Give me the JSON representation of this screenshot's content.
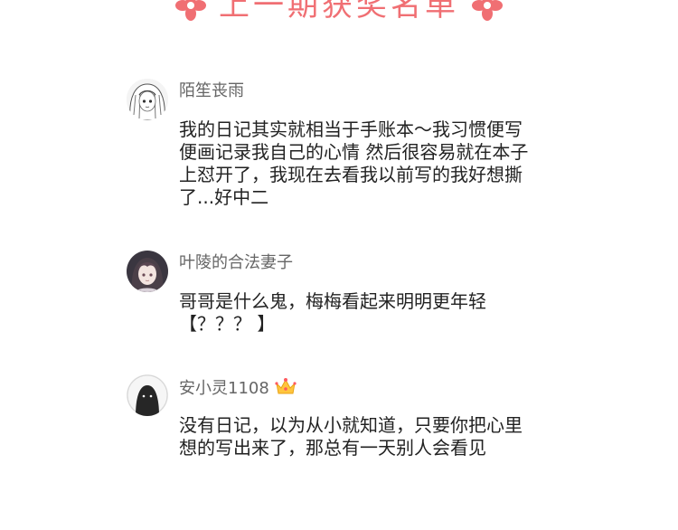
{
  "header": {
    "title": "上一期获奖名单",
    "accent_color": "#f06f73",
    "left_icon": "flower-icon",
    "right_icon": "flower-icon"
  },
  "comments": [
    {
      "username": "陌笙丧雨",
      "avatar": "anime-girl-avatar",
      "text": "我的日记其实就相当于手账本～我习惯便写\n便画记录我自己的心情 然后很容易就在本子\n上怼开了，我现在去看我以前写的我好想撕\n了...好中二"
    },
    {
      "username": "叶陵的合法妻子",
      "avatar": "anime-boy-avatar",
      "text": "哥哥是什么鬼，梅梅看起来明明更年轻\n【？？？ 】"
    },
    {
      "username": "安小灵1108",
      "avatar": "default-user-avatar",
      "badge": "crown-icon",
      "text": "没有日记，以为从小就知道，只要你把心里\n想的写出来了，那总有一天别人会看见"
    }
  ]
}
